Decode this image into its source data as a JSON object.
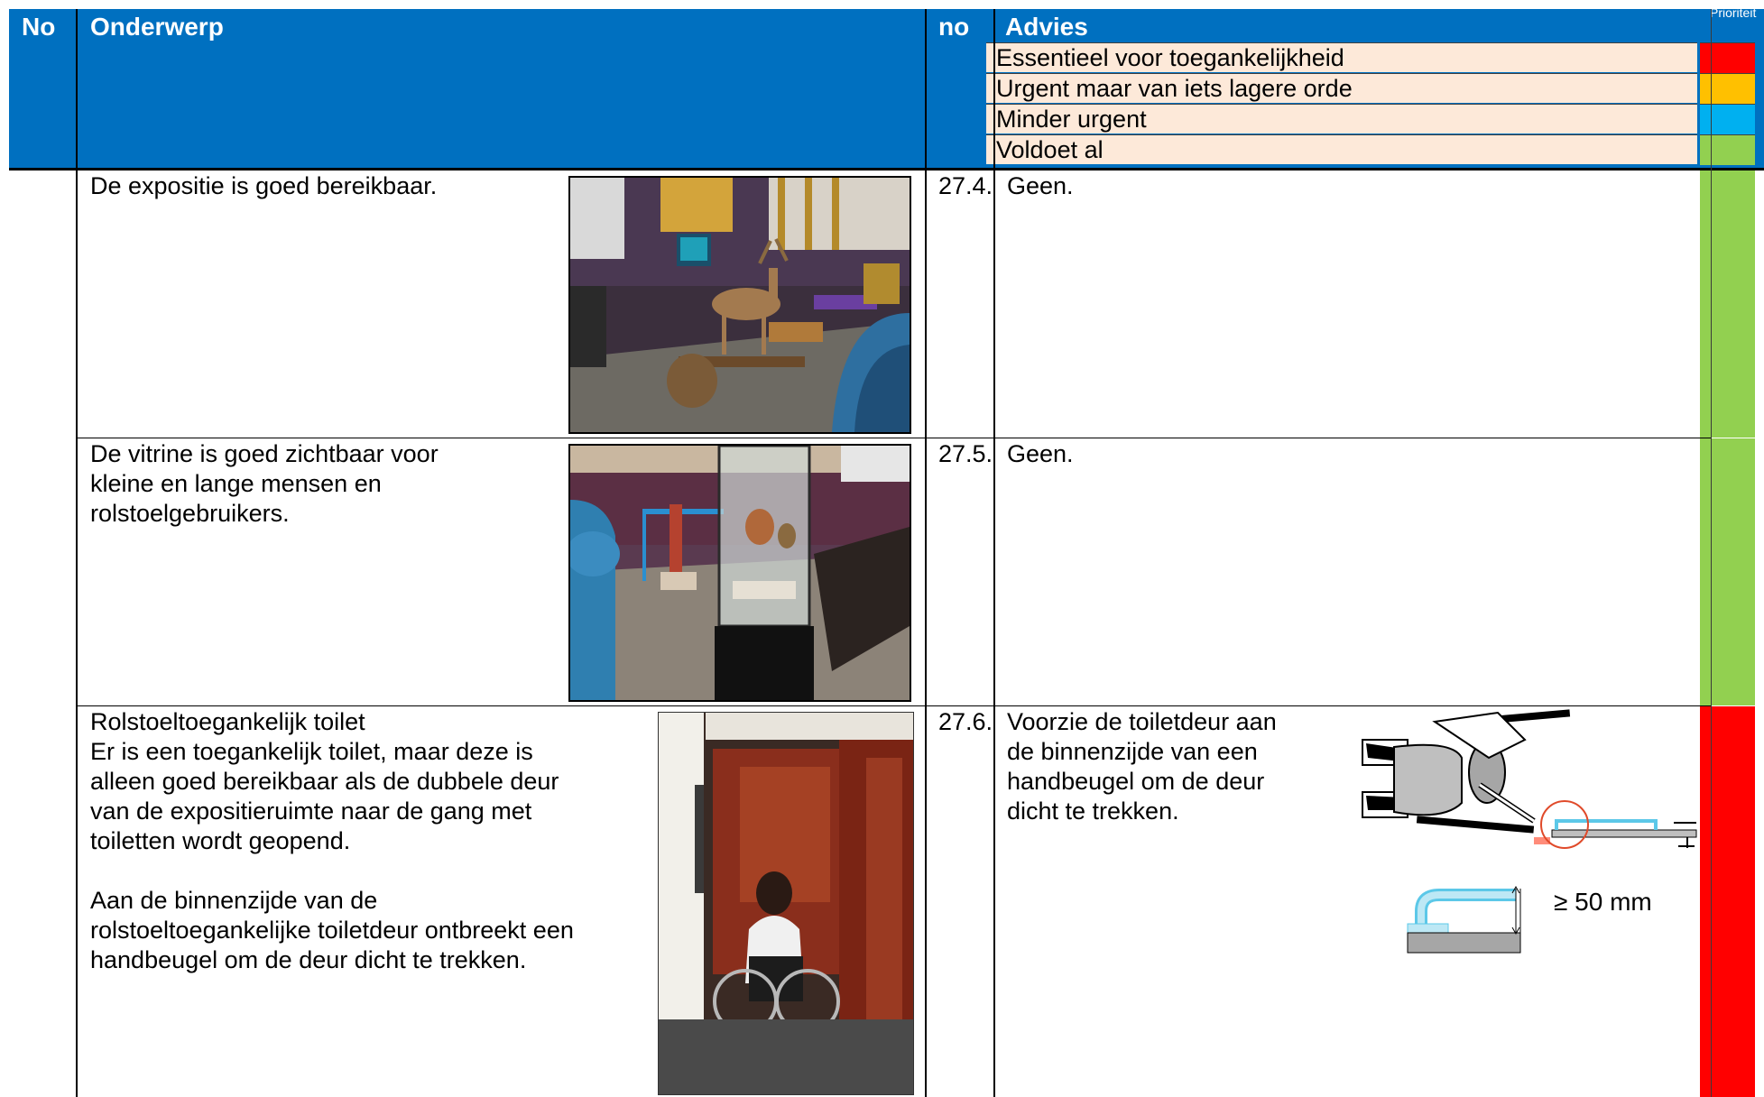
{
  "header": {
    "no_left": "No",
    "onderwerp": "Onderwerp",
    "no_right": "no",
    "advies": "Advies",
    "prioriteit": "Prioriteit"
  },
  "legend": [
    {
      "label": "Essentieel voor toegankelijkheid",
      "color": "#ff0000"
    },
    {
      "label": "Urgent maar van iets lagere orde",
      "color": "#ffc000"
    },
    {
      "label": "Minder urgent",
      "color": "#00b0f0"
    },
    {
      "label": "Voldoet al",
      "color": "#92d050"
    }
  ],
  "rows": [
    {
      "onderwerp": "De expositie is goed bereikbaar.",
      "no": "27.4.",
      "advies": "Geen.",
      "priority_color": "#92d050",
      "photo": "museum-hall-with-deer-photo"
    },
    {
      "onderwerp": "De vitrine is goed zichtbaar voor\nkleine en lange mensen en\nrolstoelgebruikers.",
      "no": "27.5.",
      "advies": "Geen.",
      "priority_color": "#92d050",
      "photo": "glass-display-case-photo"
    },
    {
      "onderwerp": "Rolstoeltoegankelijk toilet\nEr is een toegankelijk toilet, maar deze is\nalleen goed bereikbaar als de dubbele deur\nvan de expositieruimte naar de gang met\ntoiletten wordt geopend.\n\nAan de binnenzijde van de\nrolstoeltoegankelijke toiletdeur ontbreekt een\nhandbeugel om de deur dicht te trekken.",
      "no": "27.6.",
      "advies": "Voorzie de toiletdeur aan\nde binnenzijde van een\nhandbeugel om de deur\ndicht te trekken.",
      "priority_color": "#ff0000",
      "photo": "wheelchair-user-toilet-photo",
      "diagram_label": "≥ 50 mm"
    }
  ]
}
